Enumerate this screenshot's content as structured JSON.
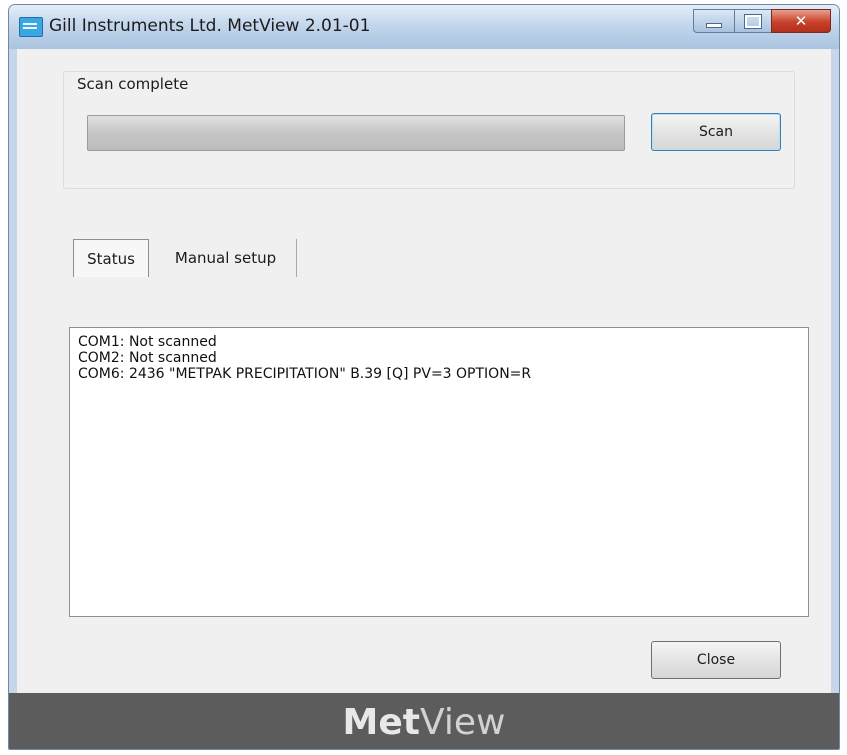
{
  "window": {
    "title": "Gill Instruments Ltd. MetView 2.01-01",
    "icon": "app-icon",
    "controls": [
      "minimize",
      "maximize",
      "close"
    ]
  },
  "scan": {
    "group_label": "Scan complete",
    "progress_percent": 100,
    "scan_button": "Scan"
  },
  "tabs": [
    {
      "label": "Status",
      "selected": true
    },
    {
      "label": "Manual setup",
      "selected": false
    }
  ],
  "status": {
    "lines": [
      "COM1: Not scanned",
      "COM2: Not scanned",
      "COM6: 2436 \"METPAK PRECIPITATION\" B.39 [Q] PV=3 OPTION=R"
    ]
  },
  "close_button": "Close",
  "footer": {
    "brand_bold": "Met",
    "brand_light": "View"
  },
  "colors": {
    "footer_bg": "#5c5c5c",
    "close_ctrl": "#c9412b",
    "window_frame": "#c6d6e8"
  }
}
